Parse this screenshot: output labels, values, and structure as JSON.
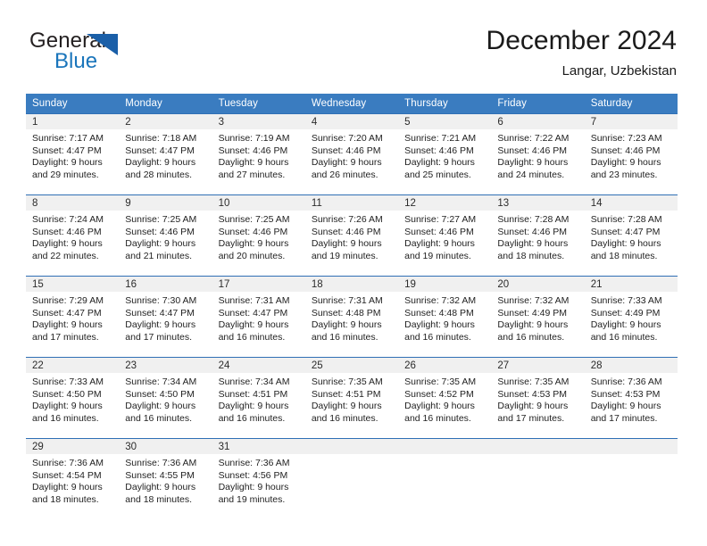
{
  "brand": {
    "name_part1": "General",
    "name_part2": "Blue"
  },
  "header": {
    "month_title": "December 2024",
    "location": "Langar, Uzbekistan"
  },
  "colors": {
    "header_blue": "#3a7cc0",
    "row_rule_blue": "#2f6fb5",
    "daynum_band": "#f0f0f0",
    "logo_blue": "#1a75bb",
    "logo_triangle": "#1a5fa8",
    "text": "#1f1f1f"
  },
  "weekday_headers": [
    "Sunday",
    "Monday",
    "Tuesday",
    "Wednesday",
    "Thursday",
    "Friday",
    "Saturday"
  ],
  "weeks": [
    [
      {
        "day": "1",
        "sunrise": "Sunrise: 7:17 AM",
        "sunset": "Sunset: 4:47 PM",
        "daylight_line1": "Daylight: 9 hours",
        "daylight_line2": "and 29 minutes."
      },
      {
        "day": "2",
        "sunrise": "Sunrise: 7:18 AM",
        "sunset": "Sunset: 4:47 PM",
        "daylight_line1": "Daylight: 9 hours",
        "daylight_line2": "and 28 minutes."
      },
      {
        "day": "3",
        "sunrise": "Sunrise: 7:19 AM",
        "sunset": "Sunset: 4:46 PM",
        "daylight_line1": "Daylight: 9 hours",
        "daylight_line2": "and 27 minutes."
      },
      {
        "day": "4",
        "sunrise": "Sunrise: 7:20 AM",
        "sunset": "Sunset: 4:46 PM",
        "daylight_line1": "Daylight: 9 hours",
        "daylight_line2": "and 26 minutes."
      },
      {
        "day": "5",
        "sunrise": "Sunrise: 7:21 AM",
        "sunset": "Sunset: 4:46 PM",
        "daylight_line1": "Daylight: 9 hours",
        "daylight_line2": "and 25 minutes."
      },
      {
        "day": "6",
        "sunrise": "Sunrise: 7:22 AM",
        "sunset": "Sunset: 4:46 PM",
        "daylight_line1": "Daylight: 9 hours",
        "daylight_line2": "and 24 minutes."
      },
      {
        "day": "7",
        "sunrise": "Sunrise: 7:23 AM",
        "sunset": "Sunset: 4:46 PM",
        "daylight_line1": "Daylight: 9 hours",
        "daylight_line2": "and 23 minutes."
      }
    ],
    [
      {
        "day": "8",
        "sunrise": "Sunrise: 7:24 AM",
        "sunset": "Sunset: 4:46 PM",
        "daylight_line1": "Daylight: 9 hours",
        "daylight_line2": "and 22 minutes."
      },
      {
        "day": "9",
        "sunrise": "Sunrise: 7:25 AM",
        "sunset": "Sunset: 4:46 PM",
        "daylight_line1": "Daylight: 9 hours",
        "daylight_line2": "and 21 minutes."
      },
      {
        "day": "10",
        "sunrise": "Sunrise: 7:25 AM",
        "sunset": "Sunset: 4:46 PM",
        "daylight_line1": "Daylight: 9 hours",
        "daylight_line2": "and 20 minutes."
      },
      {
        "day": "11",
        "sunrise": "Sunrise: 7:26 AM",
        "sunset": "Sunset: 4:46 PM",
        "daylight_line1": "Daylight: 9 hours",
        "daylight_line2": "and 19 minutes."
      },
      {
        "day": "12",
        "sunrise": "Sunrise: 7:27 AM",
        "sunset": "Sunset: 4:46 PM",
        "daylight_line1": "Daylight: 9 hours",
        "daylight_line2": "and 19 minutes."
      },
      {
        "day": "13",
        "sunrise": "Sunrise: 7:28 AM",
        "sunset": "Sunset: 4:46 PM",
        "daylight_line1": "Daylight: 9 hours",
        "daylight_line2": "and 18 minutes."
      },
      {
        "day": "14",
        "sunrise": "Sunrise: 7:28 AM",
        "sunset": "Sunset: 4:47 PM",
        "daylight_line1": "Daylight: 9 hours",
        "daylight_line2": "and 18 minutes."
      }
    ],
    [
      {
        "day": "15",
        "sunrise": "Sunrise: 7:29 AM",
        "sunset": "Sunset: 4:47 PM",
        "daylight_line1": "Daylight: 9 hours",
        "daylight_line2": "and 17 minutes."
      },
      {
        "day": "16",
        "sunrise": "Sunrise: 7:30 AM",
        "sunset": "Sunset: 4:47 PM",
        "daylight_line1": "Daylight: 9 hours",
        "daylight_line2": "and 17 minutes."
      },
      {
        "day": "17",
        "sunrise": "Sunrise: 7:31 AM",
        "sunset": "Sunset: 4:47 PM",
        "daylight_line1": "Daylight: 9 hours",
        "daylight_line2": "and 16 minutes."
      },
      {
        "day": "18",
        "sunrise": "Sunrise: 7:31 AM",
        "sunset": "Sunset: 4:48 PM",
        "daylight_line1": "Daylight: 9 hours",
        "daylight_line2": "and 16 minutes."
      },
      {
        "day": "19",
        "sunrise": "Sunrise: 7:32 AM",
        "sunset": "Sunset: 4:48 PM",
        "daylight_line1": "Daylight: 9 hours",
        "daylight_line2": "and 16 minutes."
      },
      {
        "day": "20",
        "sunrise": "Sunrise: 7:32 AM",
        "sunset": "Sunset: 4:49 PM",
        "daylight_line1": "Daylight: 9 hours",
        "daylight_line2": "and 16 minutes."
      },
      {
        "day": "21",
        "sunrise": "Sunrise: 7:33 AM",
        "sunset": "Sunset: 4:49 PM",
        "daylight_line1": "Daylight: 9 hours",
        "daylight_line2": "and 16 minutes."
      }
    ],
    [
      {
        "day": "22",
        "sunrise": "Sunrise: 7:33 AM",
        "sunset": "Sunset: 4:50 PM",
        "daylight_line1": "Daylight: 9 hours",
        "daylight_line2": "and 16 minutes."
      },
      {
        "day": "23",
        "sunrise": "Sunrise: 7:34 AM",
        "sunset": "Sunset: 4:50 PM",
        "daylight_line1": "Daylight: 9 hours",
        "daylight_line2": "and 16 minutes."
      },
      {
        "day": "24",
        "sunrise": "Sunrise: 7:34 AM",
        "sunset": "Sunset: 4:51 PM",
        "daylight_line1": "Daylight: 9 hours",
        "daylight_line2": "and 16 minutes."
      },
      {
        "day": "25",
        "sunrise": "Sunrise: 7:35 AM",
        "sunset": "Sunset: 4:51 PM",
        "daylight_line1": "Daylight: 9 hours",
        "daylight_line2": "and 16 minutes."
      },
      {
        "day": "26",
        "sunrise": "Sunrise: 7:35 AM",
        "sunset": "Sunset: 4:52 PM",
        "daylight_line1": "Daylight: 9 hours",
        "daylight_line2": "and 16 minutes."
      },
      {
        "day": "27",
        "sunrise": "Sunrise: 7:35 AM",
        "sunset": "Sunset: 4:53 PM",
        "daylight_line1": "Daylight: 9 hours",
        "daylight_line2": "and 17 minutes."
      },
      {
        "day": "28",
        "sunrise": "Sunrise: 7:36 AM",
        "sunset": "Sunset: 4:53 PM",
        "daylight_line1": "Daylight: 9 hours",
        "daylight_line2": "and 17 minutes."
      }
    ],
    [
      {
        "day": "29",
        "sunrise": "Sunrise: 7:36 AM",
        "sunset": "Sunset: 4:54 PM",
        "daylight_line1": "Daylight: 9 hours",
        "daylight_line2": "and 18 minutes."
      },
      {
        "day": "30",
        "sunrise": "Sunrise: 7:36 AM",
        "sunset": "Sunset: 4:55 PM",
        "daylight_line1": "Daylight: 9 hours",
        "daylight_line2": "and 18 minutes."
      },
      {
        "day": "31",
        "sunrise": "Sunrise: 7:36 AM",
        "sunset": "Sunset: 4:56 PM",
        "daylight_line1": "Daylight: 9 hours",
        "daylight_line2": "and 19 minutes."
      },
      {
        "day": "",
        "sunrise": "",
        "sunset": "",
        "daylight_line1": "",
        "daylight_line2": ""
      },
      {
        "day": "",
        "sunrise": "",
        "sunset": "",
        "daylight_line1": "",
        "daylight_line2": ""
      },
      {
        "day": "",
        "sunrise": "",
        "sunset": "",
        "daylight_line1": "",
        "daylight_line2": ""
      },
      {
        "day": "",
        "sunrise": "",
        "sunset": "",
        "daylight_line1": "",
        "daylight_line2": ""
      }
    ]
  ]
}
